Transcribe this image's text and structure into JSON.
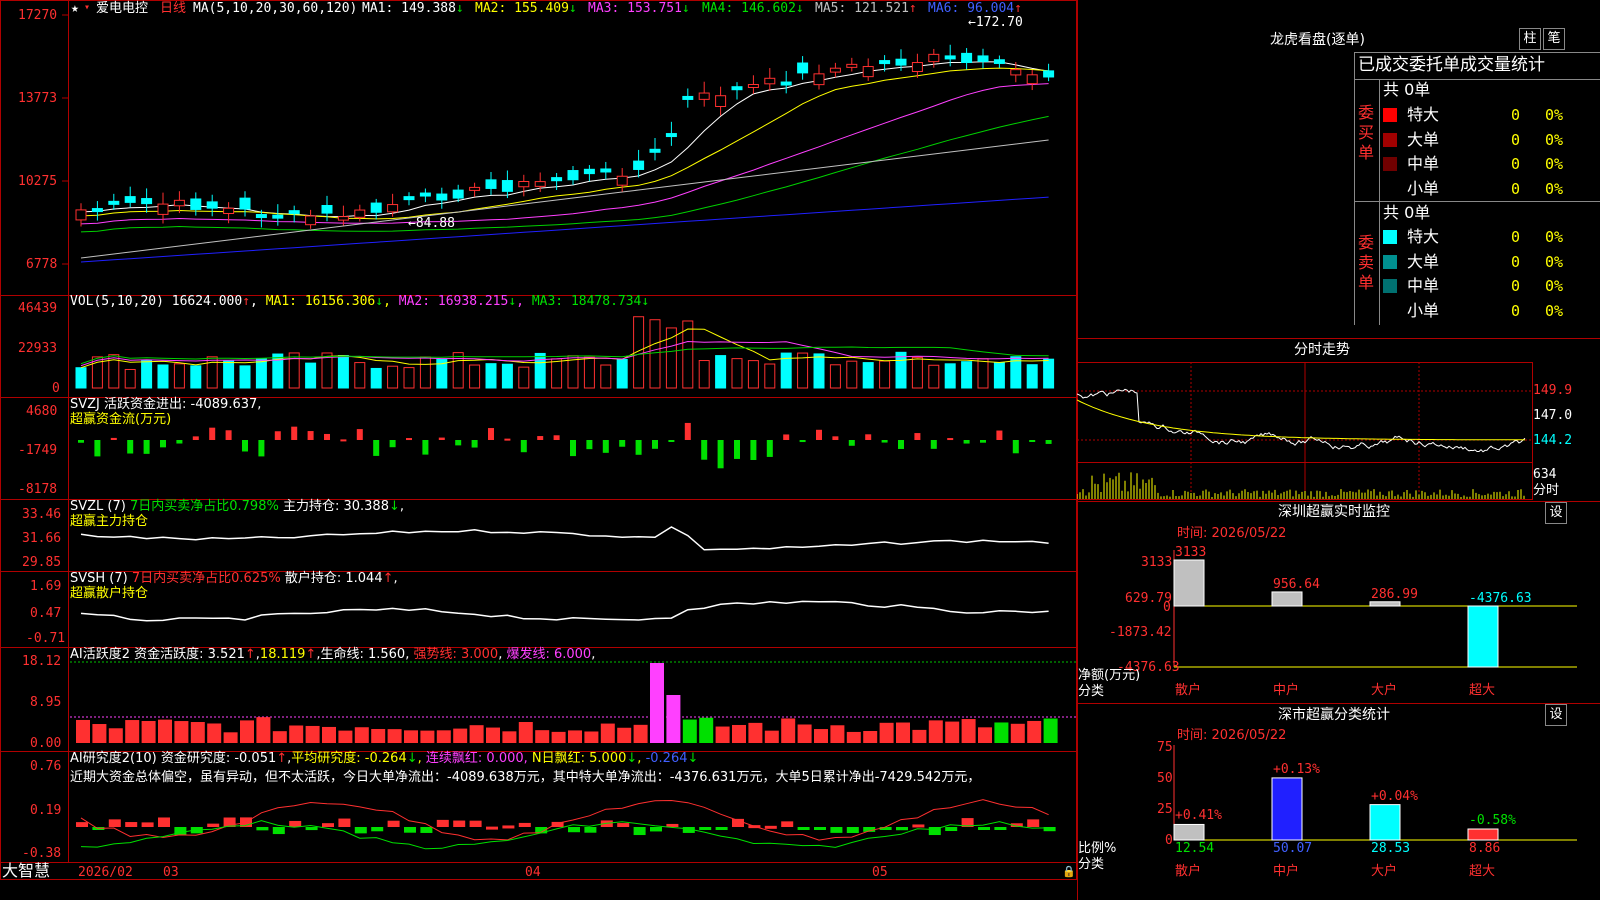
{
  "chart_title": {
    "stock_name": "爱电电控",
    "period": "日线",
    "ma_label": "MA(5,10,20,30,60,120)",
    "ma1": "MA1: 149.388",
    "ma2": "MA2: 155.409",
    "ma3": "MA3: 153.751",
    "ma4": "MA4: 146.602",
    "ma5": "MA5: 121.521",
    "ma6": "MA6: 96.004"
  },
  "price_axis": [
    "17270",
    "13773",
    "10275",
    "6778"
  ],
  "price_marks": {
    "high": "172.70",
    "low": "84.88"
  },
  "vol_panel": {
    "label": "VOL(5,10,20)",
    "value": "16624.000",
    "ma1": "MA1: 16156.306",
    "ma2": "MA2: 16938.215",
    "ma3": "MA3: 18478.734",
    "axis": [
      "46439",
      "22933",
      "0"
    ]
  },
  "svzj_panel": {
    "label": "SVZJ",
    "text": "活跃资金进出: -4089.637",
    "subtitle": "超赢资金流(万元)",
    "axis": [
      "4680",
      "-1749",
      "-8178"
    ]
  },
  "svzl_panel": {
    "label": "SVZL (7)",
    "ratio": "7日内买卖净占比0.798%",
    "holding": "主力持仓: 30.388",
    "subtitle": "超赢主力持仓",
    "axis": [
      "33.46",
      "31.66",
      "29.85"
    ]
  },
  "svsh_panel": {
    "label": "SVSH (7)",
    "ratio": "7日内买卖净占比0.625%",
    "holding": "散户持仓: 1.044",
    "subtitle": "超赢散户持仓",
    "axis": [
      "1.69",
      "0.47",
      "-0.71"
    ]
  },
  "ai_active_panel": {
    "label": "AI活跃度2",
    "active": "资金活跃度: 3.521",
    "v2": "18.119",
    "life": "生命线: 1.560",
    "strong": "强势线: 3.000",
    "burst": "爆发线: 6.000",
    "axis": [
      "18.12",
      "8.95",
      "0.00"
    ]
  },
  "ai_research_panel": {
    "label": "AI研究度2(10)",
    "research": "资金研究度: -0.051",
    "avg": "平均研究度: -0.264",
    "streak": "连续飘红: 0.000",
    "nday": "N日飘红: 5.000",
    "last": "-0.264",
    "summary": "近期大资金总体偏空，虽有异动，但不太活跃，今日大单净流出：-4089.638万元，其中特大单净流出：-4376.631万元，大单5日累计净出-7429.542万元，",
    "axis": [
      "0.76",
      "0.19",
      "-0.38"
    ]
  },
  "bottom_bar": {
    "brand": "大智慧",
    "dates": [
      "2026/02",
      "03",
      "04",
      "05"
    ]
  },
  "dragon_panel": {
    "title": "龙虎看盘(逐单)",
    "tab1": "柱",
    "tab2": "笔",
    "header": "已成交委托单成交量统计",
    "buy_total": "共 0单",
    "buy_label": "委买单",
    "sell_total": "共 0单",
    "sell_label": "委卖单",
    "rows": [
      {
        "name": "特大",
        "count": "0",
        "pct": "0%"
      },
      {
        "name": "大单",
        "count": "0",
        "pct": "0%"
      },
      {
        "name": "中单",
        "count": "0",
        "pct": "0%"
      },
      {
        "name": "小单",
        "count": "0",
        "pct": "0%"
      }
    ],
    "buy_colors": [
      "#ff0000",
      "#a00000",
      "#700000",
      "#000000"
    ],
    "sell_colors": [
      "#00ffff",
      "#009090",
      "#007070",
      "#000000"
    ]
  },
  "intraday_panel": {
    "title": "分时走势",
    "axis_right": [
      "149.9",
      "147.0",
      "144.2",
      "634",
      "分时"
    ]
  },
  "sz_monitor": {
    "title": "深圳超赢实时监控",
    "set": "设",
    "time": "时间: 2026/05/22",
    "axis": [
      "3133",
      "629.79",
      "0",
      "-1873.42",
      "-4376.63"
    ],
    "ylabel": "净额(万元)",
    "xlabel": "分类",
    "categories": [
      "散户",
      "中户",
      "大户",
      "超大"
    ],
    "values": [
      3133,
      956.64,
      286.99,
      -4376.63
    ],
    "labels": [
      "3133",
      "956.64",
      "286.99",
      "-4376.63"
    ]
  },
  "sz_class": {
    "title": "深市超赢分类统计",
    "set": "设",
    "time": "时间: 2026/05/22",
    "axis": [
      "75",
      "50",
      "25",
      "0"
    ],
    "ylabel": "比例%",
    "xlabel": "分类",
    "categories": [
      "散户",
      "中户",
      "大户",
      "超大"
    ],
    "values": [
      12.54,
      50.07,
      28.53,
      8.86
    ],
    "labels": [
      "12.54",
      "50.07",
      "28.53",
      "8.86"
    ],
    "changes": [
      "+0.41%",
      "+0.13%",
      "+0.04%",
      "-0.58%"
    ]
  },
  "colors": {
    "up": "#ff3030",
    "down": "#00ffff",
    "grid": "#b00000",
    "ma1": "#ffffff",
    "ma2": "#ffff00",
    "ma3": "#ff40ff",
    "ma4": "#00d000",
    "ma5": "#c0c0c0",
    "ma6": "#2020ff"
  }
}
